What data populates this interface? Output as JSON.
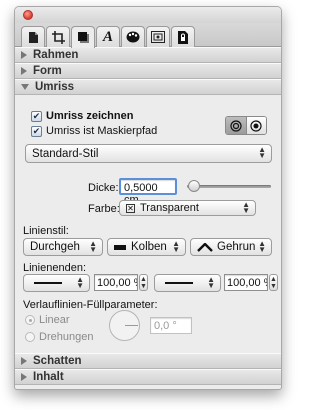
{
  "tabs": [
    {
      "icon": "document-icon"
    },
    {
      "icon": "crop-frame-icon"
    },
    {
      "icon": "shadow-square-icon",
      "selected": true
    },
    {
      "icon": "font-a-icon"
    },
    {
      "icon": "palette-icon"
    },
    {
      "icon": "image-frame-icon"
    },
    {
      "icon": "lock-document-icon"
    }
  ],
  "sections": {
    "rahmen": "Rahmen",
    "form": "Form",
    "umriss": "Umriss",
    "schatten": "Schatten",
    "inhalt": "Inhalt"
  },
  "umriss": {
    "draw_outline": {
      "label": "Umriss zeichnen",
      "checked": true
    },
    "mask_path": {
      "label": "Umriss ist Maskierpfad",
      "checked": true
    },
    "style_select": "Standard-Stil",
    "thickness": {
      "label": "Dicke:",
      "value": "0,5000 cm",
      "slider": 0.08
    },
    "color": {
      "label": "Farbe:",
      "value": "Transparent"
    },
    "line_style": {
      "label": "Linienstil:",
      "dash": "Durchgeh",
      "cap": "Kolben",
      "join": "Gehrun"
    },
    "line_ends": {
      "label": "Linienenden:",
      "start_scale": "100,00 %",
      "end_scale": "100,00 %"
    },
    "gradient": {
      "label": "Verlauflinien-Füllparameter:",
      "linear": "Linear",
      "rotations": "Drehungen",
      "angle": "0,0 °",
      "selected": "linear"
    }
  },
  "colors": {
    "accent": "#5b8fd9",
    "window_bg": "#ececec"
  }
}
